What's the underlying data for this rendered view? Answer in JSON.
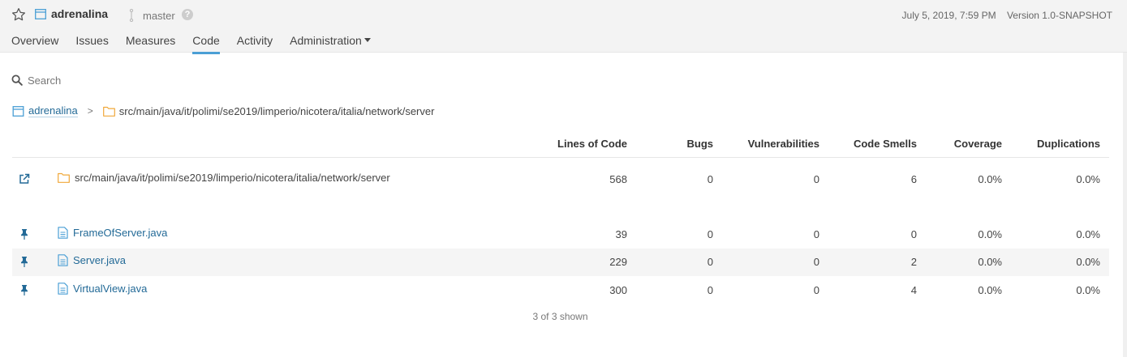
{
  "header": {
    "project_name": "adrenalina",
    "branch": "master",
    "date": "July 5, 2019, 7:59 PM",
    "version": "Version 1.0-SNAPSHOT"
  },
  "nav": {
    "tabs": [
      {
        "label": "Overview",
        "active": false
      },
      {
        "label": "Issues",
        "active": false
      },
      {
        "label": "Measures",
        "active": false
      },
      {
        "label": "Code",
        "active": true
      },
      {
        "label": "Activity",
        "active": false
      },
      {
        "label": "Administration",
        "active": false
      }
    ]
  },
  "search": {
    "placeholder": "Search"
  },
  "breadcrumb": {
    "project": "adrenalina",
    "separator": ">",
    "path": "src/main/java/it/polimi/se2019/limperio/nicotera/italia/network/server"
  },
  "table": {
    "columns": [
      "Lines of Code",
      "Bugs",
      "Vulnerabilities",
      "Code Smells",
      "Coverage",
      "Duplications"
    ],
    "base_row": {
      "icon": "external-link-icon",
      "name": "src/main/java/it/polimi/se2019/limperio/nicotera/italia/network/server",
      "values": [
        "568",
        "0",
        "0",
        "6",
        "0.0%",
        "0.0%"
      ]
    },
    "rows": [
      {
        "icon": "pin-icon",
        "name": "FrameOfServer.java",
        "values": [
          "39",
          "0",
          "0",
          "0",
          "0.0%",
          "0.0%"
        ]
      },
      {
        "icon": "pin-icon",
        "name": "Server.java",
        "values": [
          "229",
          "0",
          "0",
          "2",
          "0.0%",
          "0.0%"
        ]
      },
      {
        "icon": "pin-icon",
        "name": "VirtualView.java",
        "values": [
          "300",
          "0",
          "0",
          "4",
          "0.0%",
          "0.0%"
        ]
      }
    ]
  },
  "footer": {
    "shown": "3 of 3 shown"
  },
  "colors": {
    "accent": "#4b9fd5",
    "link": "#236a97",
    "folder": "#f0a83a",
    "row_highlight": "#f5f5f5"
  }
}
